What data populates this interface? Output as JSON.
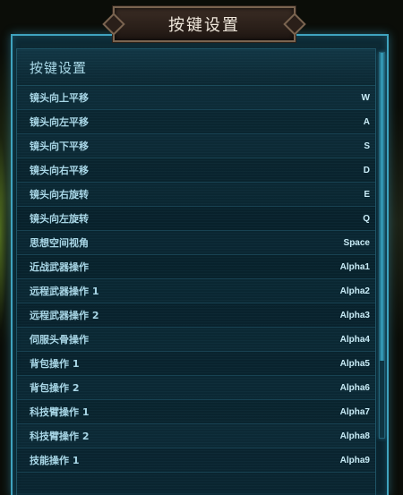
{
  "window": {
    "title": "按键设置"
  },
  "panel": {
    "section_title": "按键设置",
    "bindings": [
      {
        "action": "镜头向上平移",
        "key": "W"
      },
      {
        "action": "镜头向左平移",
        "key": "A"
      },
      {
        "action": "镜头向下平移",
        "key": "S"
      },
      {
        "action": "镜头向右平移",
        "key": "D"
      },
      {
        "action": "镜头向右旋转",
        "key": "E"
      },
      {
        "action": "镜头向左旋转",
        "key": "Q"
      },
      {
        "action": "思想空间视角",
        "key": "Space"
      },
      {
        "action": "近战武器操作",
        "key": "Alpha1"
      },
      {
        "action": "远程武器操作 1",
        "key": "Alpha2"
      },
      {
        "action": "远程武器操作 2",
        "key": "Alpha3"
      },
      {
        "action": "伺服头骨操作",
        "key": "Alpha4"
      },
      {
        "action": "背包操作 1",
        "key": "Alpha5"
      },
      {
        "action": "背包操作 2",
        "key": "Alpha6"
      },
      {
        "action": "科技臂操作 1",
        "key": "Alpha7"
      },
      {
        "action": "科技臂操作 2",
        "key": "Alpha8"
      },
      {
        "action": "技能操作 1",
        "key": "Alpha9"
      }
    ]
  },
  "colors": {
    "panel_border": "#3fa3bf",
    "text_primary": "#a8d6e6",
    "title_plate": "#2a1f19"
  }
}
